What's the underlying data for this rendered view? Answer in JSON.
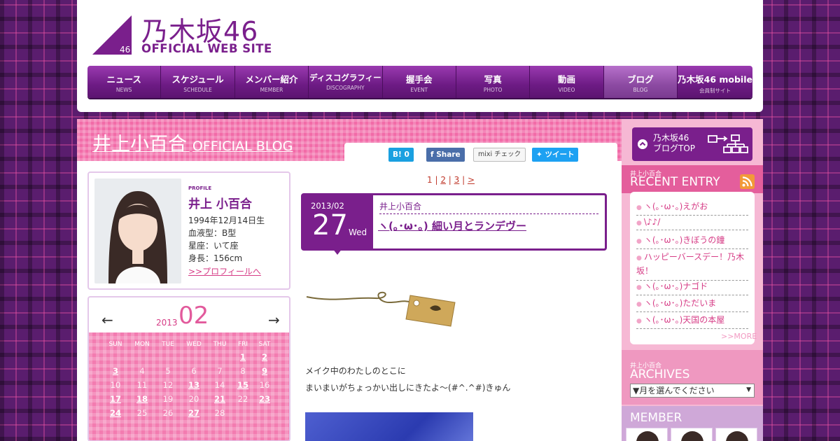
{
  "header": {
    "logo_jp": "乃木坂46",
    "logo_en": "OFFICIAL WEB SITE",
    "logo_badge": "46"
  },
  "nav": [
    {
      "jp": "ニュース",
      "en": "NEWS"
    },
    {
      "jp": "スケジュール",
      "en": "SCHEDULE"
    },
    {
      "jp": "メンバー紹介",
      "en": "MEMBER"
    },
    {
      "jp": "ディスコグラフィー",
      "en": "DISCOGRAPHY"
    },
    {
      "jp": "握手会",
      "en": "EVENT"
    },
    {
      "jp": "写真",
      "en": "PHOTO"
    },
    {
      "jp": "動画",
      "en": "VIDEO"
    },
    {
      "jp": "ブログ",
      "en": "BLOG"
    },
    {
      "jp": "乃木坂46 mobile",
      "en": "会員制サイト"
    }
  ],
  "blog": {
    "name": "井上小百合",
    "sub": "OFFICIAL BLOG"
  },
  "share": {
    "hatena": "B! 0",
    "facebook": "Share",
    "mixi": "mixi チェック",
    "tweet": "ツイート"
  },
  "profile": {
    "label": "PROFILE",
    "name": "井上 小百合",
    "birthday": "1994年12月14日生",
    "blood": "血液型：B型",
    "sign": "星座：いて座",
    "height": "身長：156cm",
    "link": ">>プロフィールへ"
  },
  "calendar": {
    "prev": "←",
    "next": "→",
    "year": "2013",
    "month": "02",
    "weekdays": [
      "SUN",
      "MON",
      "TUE",
      "WED",
      "THU",
      "FRI",
      "SAT"
    ],
    "weeks": [
      [
        "",
        "",
        "",
        "",
        "",
        "1",
        "2"
      ],
      [
        "3",
        "4",
        "5",
        "6",
        "7",
        "8",
        "9"
      ],
      [
        "10",
        "11",
        "12",
        "13",
        "14",
        "15",
        "16"
      ],
      [
        "17",
        "18",
        "19",
        "20",
        "21",
        "22",
        "23"
      ],
      [
        "24",
        "25",
        "26",
        "27",
        "28",
        "",
        ""
      ]
    ],
    "linked_days": [
      "1",
      "2",
      "3",
      "9",
      "13",
      "15",
      "17",
      "18",
      "21",
      "23",
      "24",
      "27"
    ]
  },
  "pager": {
    "current": "1",
    "pages": [
      "2",
      "3"
    ],
    "next": ">"
  },
  "entry": {
    "date_ym": "2013/02",
    "day": "27",
    "dow": "Wed",
    "author": "井上小百合",
    "title": "ヽ(｡･ω･｡) 細い月とランデヴー",
    "body_line1": "メイク中のわたしのとこに",
    "body_line2": "まいまいがちょっかい出しにきたよ～(#^.^#)きゅん"
  },
  "sidebar": {
    "blogtop_line1": "乃木坂46",
    "blogtop_line2": "ブログTOP",
    "recent_small": "井上小百合",
    "recent_title": "RECENT ENTRY",
    "recent_items": [
      "ヽ(｡･ω･｡)えがお",
      "\\♪♪/",
      "ヽ(｡･ω･｡)きぼうの鐘",
      "ハッピーバースデー！乃木坂！",
      "ヽ(｡･ω･｡)ナゴド",
      "ヽ(｡･ω･｡)ただいま",
      "ヽ(｡･ω･｡)天国の本屋"
    ],
    "more": ">>MORE",
    "archives_small": "井上小百合",
    "archives_title": "ARCHIVES",
    "archives_select": "▼月を選んでください",
    "member_title": "MEMBER"
  },
  "colors": {
    "brand_purple": "#7a1f8c",
    "pink": "#f26ba8",
    "link_pink": "#d63c86"
  }
}
